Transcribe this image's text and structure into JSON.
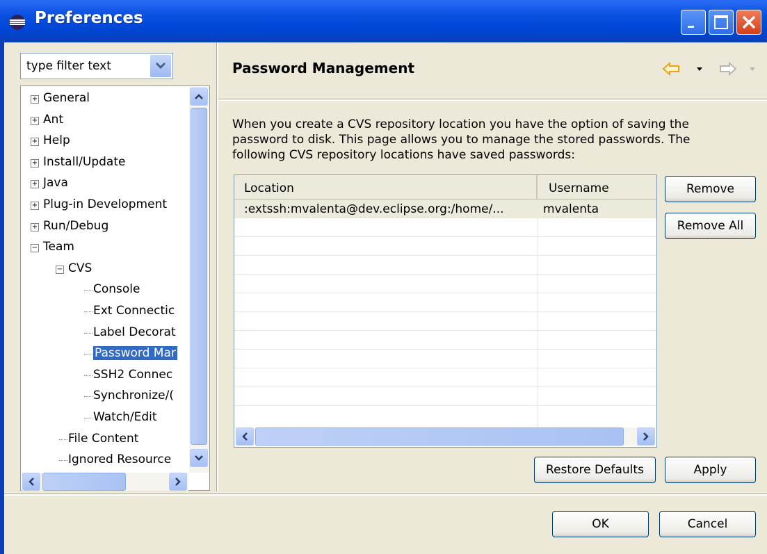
{
  "window": {
    "title": "Preferences"
  },
  "filter": {
    "placeholder": "type filter text"
  },
  "tree": [
    {
      "label": "General",
      "expander": "+"
    },
    {
      "label": "Ant",
      "expander": "+"
    },
    {
      "label": "Help",
      "expander": "+"
    },
    {
      "label": "Install/Update",
      "expander": "+"
    },
    {
      "label": "Java",
      "expander": "+"
    },
    {
      "label": "Plug-in Development",
      "expander": "+"
    },
    {
      "label": "Run/Debug",
      "expander": "+"
    },
    {
      "label": "Team",
      "expander": "−"
    },
    {
      "label": "CVS",
      "expander": "−"
    },
    {
      "label": "Console"
    },
    {
      "label": "Ext Connectic"
    },
    {
      "label": "Label Decorat"
    },
    {
      "label": "Password Mar",
      "selected": true
    },
    {
      "label": "SSH2 Connec"
    },
    {
      "label": "Synchronize/("
    },
    {
      "label": "Watch/Edit"
    },
    {
      "label": "File Content"
    },
    {
      "label": "Ignored Resource"
    }
  ],
  "page": {
    "title": "Password Management",
    "description": "When you create a CVS repository location you have the option of saving the password to disk. This page allows you to manage the stored passwords. The following CVS repository locations have saved passwords:"
  },
  "table": {
    "columns": [
      "Location",
      "Username"
    ],
    "rows": [
      {
        "location": ":extssh:mvalenta@dev.eclipse.org:/home/...",
        "username": "mvalenta"
      }
    ]
  },
  "buttons": {
    "remove": "Remove",
    "remove_all": "Remove All",
    "restore_defaults": "Restore Defaults",
    "apply": "Apply",
    "ok": "OK",
    "cancel": "Cancel"
  },
  "icons": {
    "back": "back-arrow-icon",
    "forward": "forward-arrow-icon",
    "back_color": "#e8a317",
    "forward_color": "#b4b4b4"
  },
  "colors": {
    "titlebar": "#0a51e0",
    "selection": "#316ac5",
    "dialog_bg": "#ece9d8"
  }
}
